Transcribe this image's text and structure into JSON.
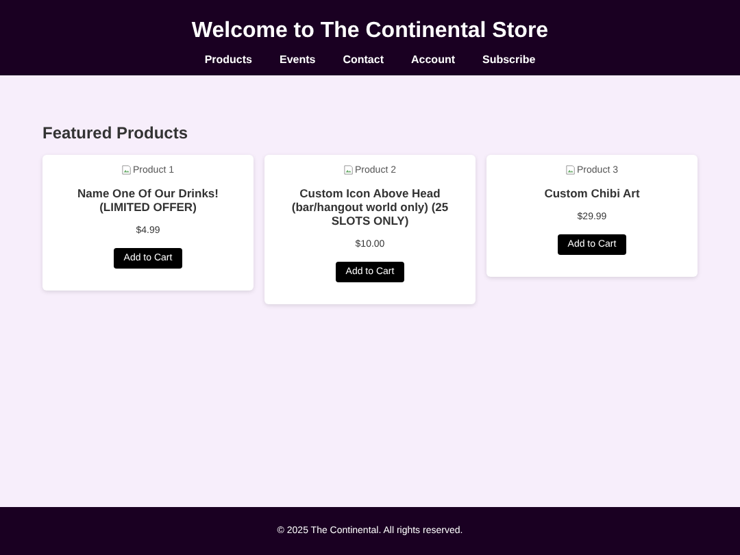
{
  "header": {
    "title": "Welcome to The Continental Store",
    "nav": [
      "Products",
      "Events",
      "Contact",
      "Account",
      "Subscribe"
    ]
  },
  "section_title": "Featured Products",
  "products": [
    {
      "image_alt": "Product 1",
      "name": "Name One Of Our Drinks! (LIMITED OFFER)",
      "price": "$4.99",
      "button": "Add to Cart"
    },
    {
      "image_alt": "Product 2",
      "name": "Custom Icon Above Head (bar/hangout world only) (25 SLOTS ONLY)",
      "price": "$10.00",
      "button": "Add to Cart"
    },
    {
      "image_alt": "Product 3",
      "name": "Custom Chibi Art",
      "price": "$29.99",
      "button": "Add to Cart"
    }
  ],
  "footer": "© 2025 The Continental. All rights reserved."
}
